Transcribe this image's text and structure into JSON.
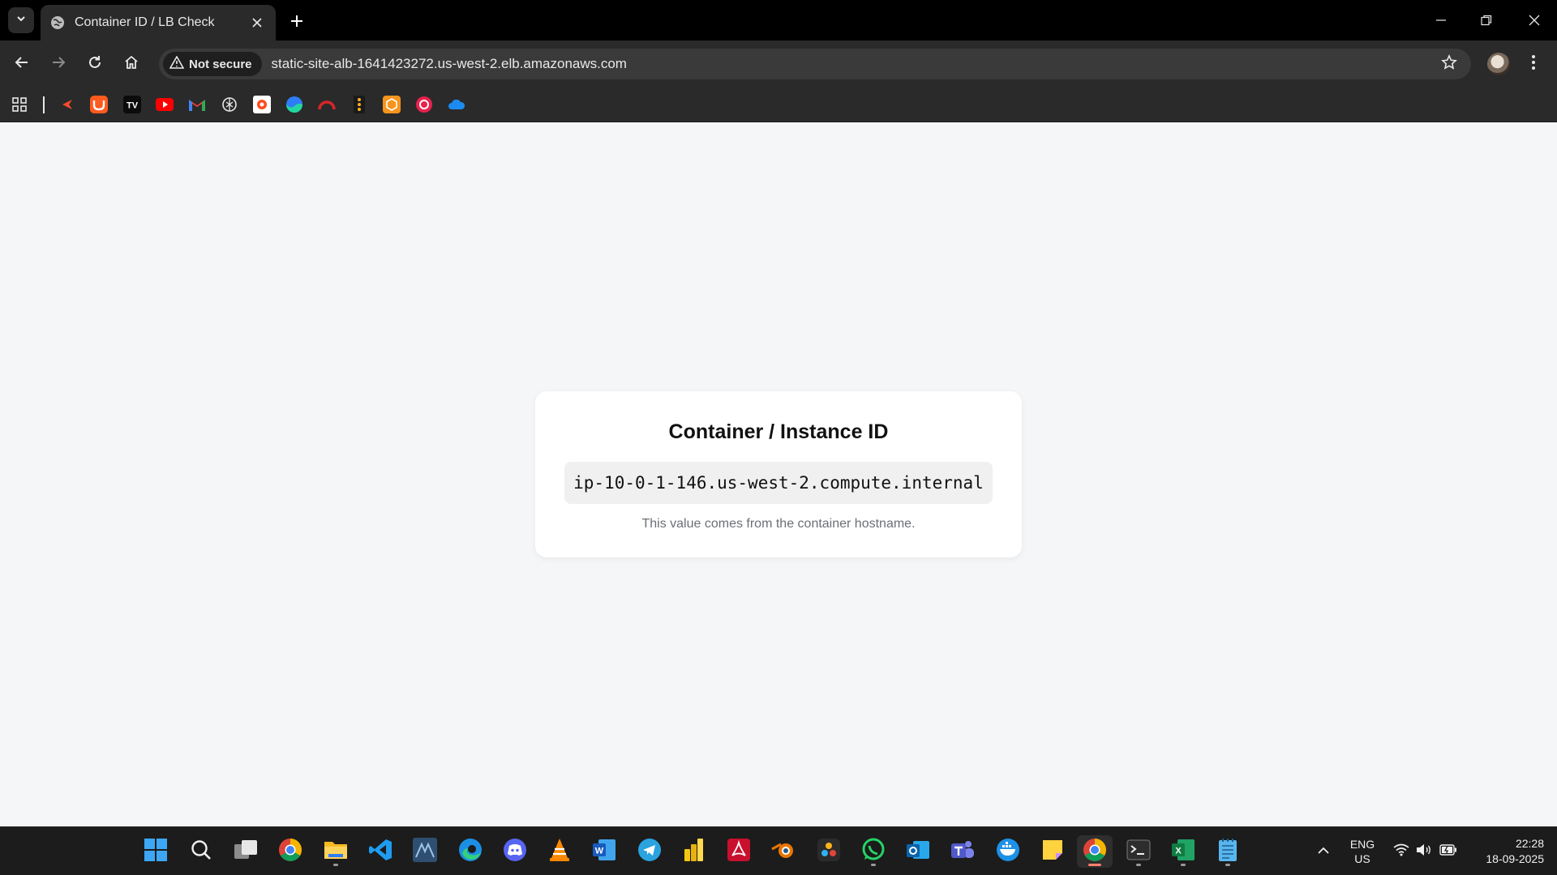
{
  "browser": {
    "tab_title": "Container ID / LB Check",
    "security_label": "Not secure",
    "url": "static-site-alb-1641423272.us-west-2.elb.amazonaws.com"
  },
  "bookmarks": [
    "apps-grid-icon",
    "bookmark-1-icon",
    "bookmark-2-icon",
    "bookmark-3-icon",
    "youtube-icon",
    "gmail-icon",
    "chatgpt-icon",
    "bookmark-7-icon",
    "bookmark-8-icon",
    "bookmark-9-icon",
    "bookmark-10-icon",
    "bookmark-11-icon",
    "bookmark-12-icon",
    "onedrive-icon"
  ],
  "page": {
    "heading": "Container / Instance ID",
    "instance_id": "ip-10-0-1-146.us-west-2.compute.internal",
    "note": "This value comes from the container hostname."
  },
  "taskbar": {
    "apps": [
      "start",
      "search",
      "task-view",
      "chrome",
      "file-explorer",
      "vscode",
      "mysql-workbench",
      "edge",
      "discord",
      "vlc",
      "word",
      "telegram",
      "power-bi",
      "acrobat",
      "blender",
      "davinci-resolve",
      "whatsapp",
      "outlook",
      "teams",
      "docker",
      "sticky-notes",
      "chrome-active",
      "terminal",
      "excel",
      "notepad"
    ],
    "language_line1": "ENG",
    "language_line2": "US",
    "time": "22:28",
    "date": "18-09-2025"
  },
  "colors": {
    "page_background": "#f5f6f8",
    "card_background": "#ffffff",
    "chrome_dark": "#2a2a2a",
    "taskbar": "#1c1c1c",
    "active_indicator": "#ff7f6e"
  }
}
